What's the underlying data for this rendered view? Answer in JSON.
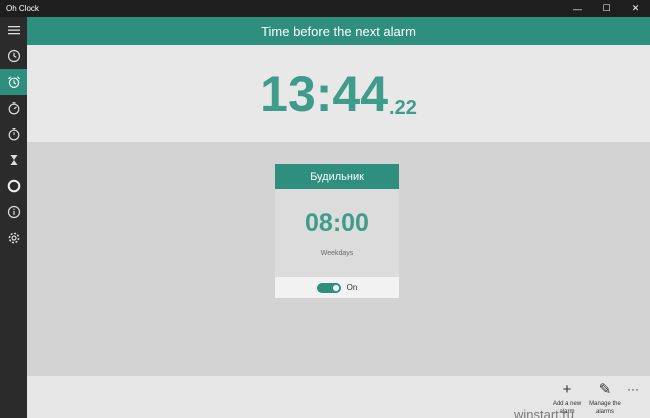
{
  "window": {
    "title": "Oh Clock",
    "minimize": "—",
    "maximize": "☐",
    "close": "✕"
  },
  "sidebar": {
    "items": [
      {
        "icon": "hamburger-menu-icon"
      },
      {
        "icon": "clock-icon"
      },
      {
        "icon": "alarm-clock-icon",
        "active": true
      },
      {
        "icon": "timer-icon"
      },
      {
        "icon": "stopwatch-icon"
      },
      {
        "icon": "hourglass-icon"
      },
      {
        "icon": "circle-icon"
      },
      {
        "icon": "info-icon"
      },
      {
        "icon": "settings-gear-icon"
      }
    ]
  },
  "header": {
    "title": "Time before the next alarm"
  },
  "countdown": {
    "main": "13:44",
    "fraction": ".22"
  },
  "alarm": {
    "name": "Будильник",
    "time": "08:00",
    "repeat": "Weekdays",
    "state": "On"
  },
  "appbar": {
    "add_icon": "+",
    "add_label": "Add a new alarm",
    "manage_icon": "✎",
    "manage_label": "Manage the alarms",
    "more": "···",
    "watermark": "winstart.ru"
  },
  "colors": {
    "accent": "#2f8f7f",
    "accent_text": "#3f9c8b",
    "sidebar_bg": "#2b2b2b",
    "titlebar_bg": "#1e1e1e"
  }
}
